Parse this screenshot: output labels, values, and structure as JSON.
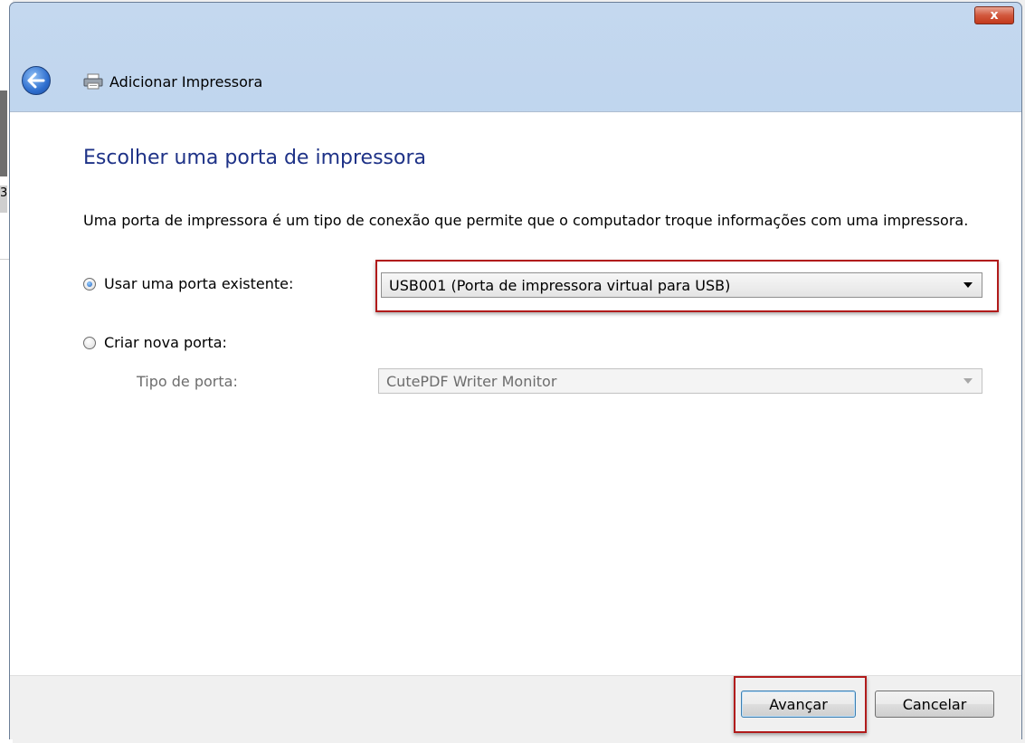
{
  "window": {
    "close_label": "x",
    "title": "Adicionar Impressora"
  },
  "page": {
    "heading": "Escolher uma porta de impressora",
    "description": "Uma porta de impressora é um tipo de conexão que permite que o computador troque informações com uma impressora."
  },
  "options": {
    "existing": {
      "label": "Usar uma porta existente:",
      "selected": true,
      "value": "USB001 (Porta de impressora virtual para USB)"
    },
    "new": {
      "label": "Criar nova porta:",
      "selected": false,
      "type_label": "Tipo de porta:",
      "type_value": "CutePDF Writer Monitor"
    }
  },
  "buttons": {
    "next": "Avançar",
    "cancel": "Cancelar"
  },
  "colors": {
    "heading": "#1e3287",
    "highlight": "#b11b1b"
  },
  "background_window": {
    "edge_char": "3"
  }
}
